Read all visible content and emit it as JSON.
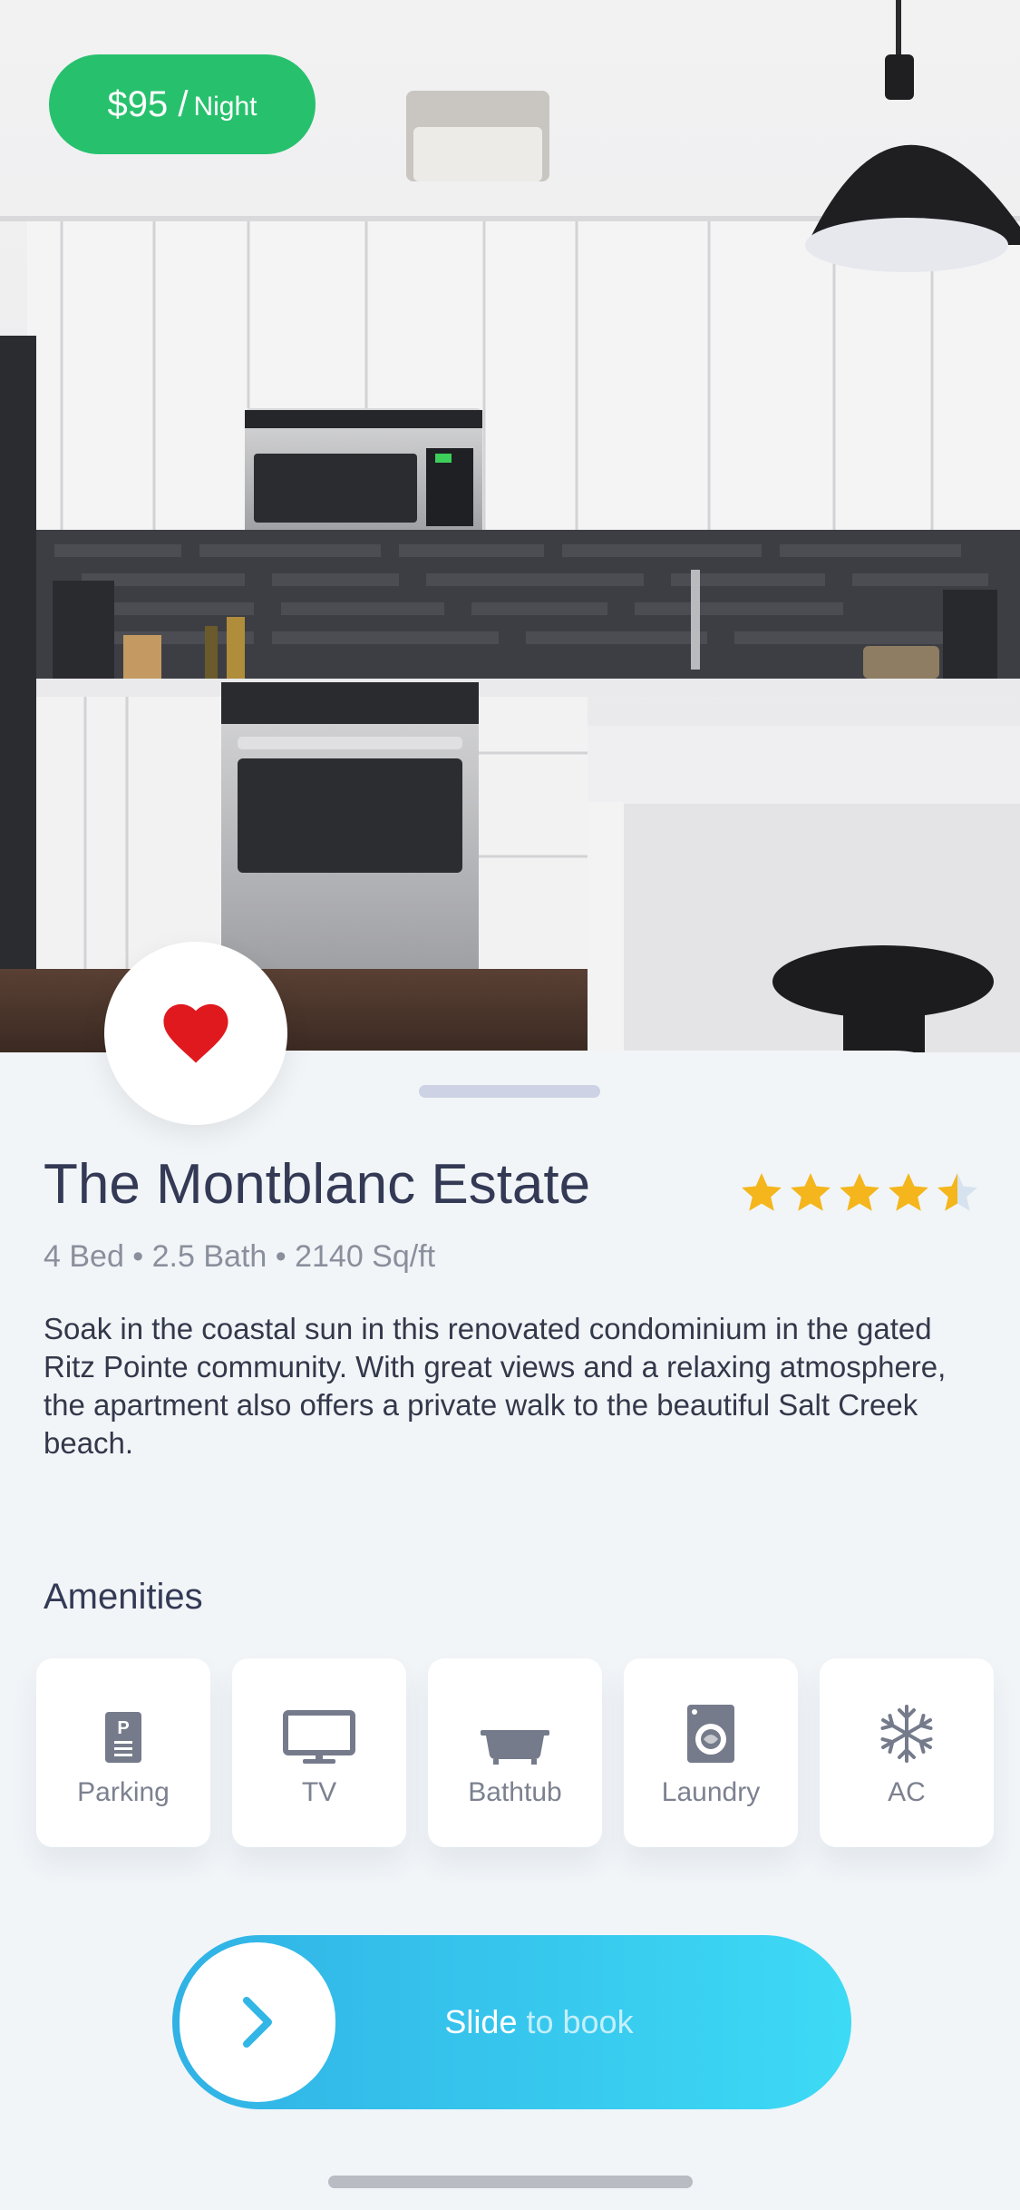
{
  "hero": {
    "image": "kitchen-photo",
    "price": {
      "amount": "$95 /",
      "unit": "Night"
    }
  },
  "favorite": {
    "icon": "heart-icon",
    "color": "#e0191f"
  },
  "listing": {
    "title": "The Montblanc Estate",
    "rating": 4.5,
    "rating_max": 5,
    "meta": "4 Bed • 2.5 Bath • 2140 Sq/ft",
    "description": "Soak in the coastal sun in this renovated condominium in the gated Ritz Pointe community. With great views and a relaxing atmosphere, the apartment also offers a private walk to the beautiful Salt Creek beach."
  },
  "amenities": {
    "title": "Amenities",
    "items": [
      {
        "label": "Parking",
        "icon": "parking-icon"
      },
      {
        "label": "TV",
        "icon": "tv-icon"
      },
      {
        "label": "Bathtub",
        "icon": "bathtub-icon"
      },
      {
        "label": "Laundry",
        "icon": "laundry-icon"
      },
      {
        "label": "AC",
        "icon": "snowflake-icon"
      }
    ]
  },
  "booking": {
    "word1": "Slide",
    "word2": "to book",
    "icon": "chevron-right-icon"
  },
  "colors": {
    "accent_green": "#27c16d",
    "star": "#f4b61c",
    "slider_start": "#30b2e5",
    "slider_end": "#3ddaf5",
    "text_dark": "#343a55"
  }
}
